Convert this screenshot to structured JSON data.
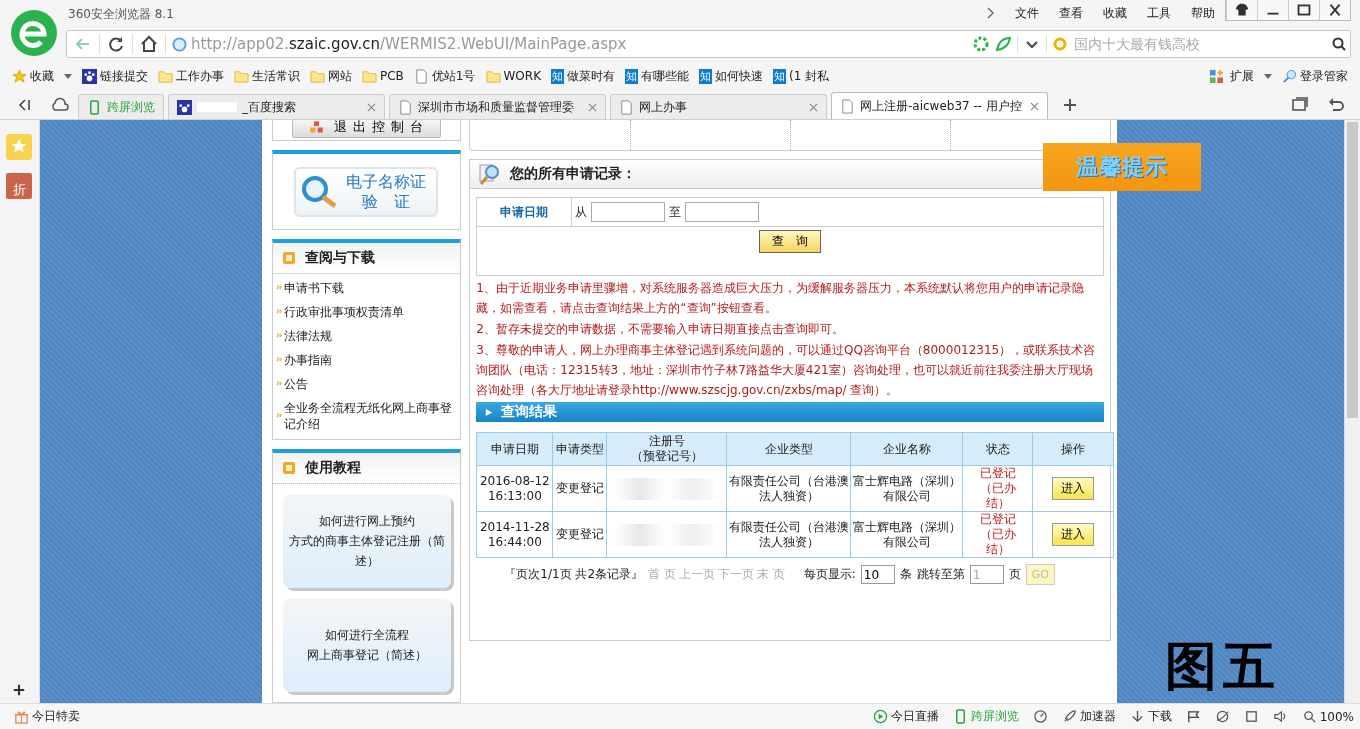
{
  "browser": {
    "title": "360安全浏览器 8.1",
    "menu": [
      "文件",
      "查看",
      "收藏",
      "工具",
      "帮助"
    ],
    "url": {
      "prefix": "http://app02.",
      "domain": "szaic.gov.cn",
      "path": "/WERMIS2.WebUI/MainPage.aspx"
    },
    "search": {
      "placeholder": "国内十大最有钱高校"
    },
    "bookmarks": [
      {
        "label": "收藏",
        "kind": "star"
      },
      {
        "label": "链接提交",
        "kind": "paw"
      },
      {
        "label": "工作办事",
        "kind": "folder"
      },
      {
        "label": "生活常识",
        "kind": "folder"
      },
      {
        "label": "网站",
        "kind": "folder"
      },
      {
        "label": "PCB",
        "kind": "folder"
      },
      {
        "label": "优站1号",
        "kind": "page"
      },
      {
        "label": "WORK",
        "kind": "folder"
      },
      {
        "label": "做菜时有",
        "kind": "zhi",
        "badge": "知"
      },
      {
        "label": "有哪些能",
        "kind": "zhi",
        "badge": "知"
      },
      {
        "label": "如何快速",
        "kind": "zhi",
        "badge": "知"
      },
      {
        "label": "(1 封私",
        "kind": "zhi",
        "badge": "知"
      }
    ],
    "bookmark_tools": [
      "扩展",
      "登录管家"
    ],
    "tabs": [
      {
        "label": "跨屏浏览",
        "kind": "phone",
        "selected": false
      },
      {
        "label": "_百度搜索",
        "kind": "paw",
        "selected": false
      },
      {
        "label": "深圳市市场和质量监督管理委",
        "kind": "page",
        "selected": false
      },
      {
        "label": "网上办事",
        "kind": "page",
        "selected": false
      },
      {
        "label": "网上注册-aicweb37 -- 用户控",
        "kind": "page",
        "selected": true
      }
    ]
  },
  "side_tools": [
    {
      "kind": "star"
    },
    {
      "kind": "sale",
      "label": "折"
    }
  ],
  "left_panel": {
    "logout_button": "退 出 控 制 台",
    "cert_button": [
      "电子名称证",
      "验　证"
    ],
    "sections": [
      {
        "title": "查阅与下载",
        "kind": "links",
        "items": [
          "申请书下载",
          "行政审批事项权责清单",
          "法律法规",
          "办事指南",
          "公告",
          "全业务全流程无纸化网上商事登记介绍"
        ]
      },
      {
        "title": "使用教程",
        "kind": "cards",
        "items": [
          [
            "如何进行网上预约",
            "方式的商事主体登记注册（简述）"
          ],
          [
            "如何进行全流程",
            "网上商事登记（简述）"
          ]
        ]
      }
    ]
  },
  "main": {
    "title": "您的所有申请记录：",
    "warm_tip": "温馨提示",
    "form": {
      "label": "申请日期",
      "from": "从",
      "to": "至",
      "button": "查　询"
    },
    "notices": [
      "1、由于近期业务申请里骤增，对系统服务器造成巨大压力，为缓解服务器压力，本系统默认将您用户的申请记录隐藏，如需查看，请点击查询结果上方的“查询”按钮查看。",
      "2、暂存未提交的申请数据，不需要输入申请日期直接点击查询即可。",
      "3、尊敬的申请人，网上办理商事主体登记遇到系统问题的，可以通过QQ咨询平台（8000012315），或联系技术咨询团队（电话：12315转3，地址：深圳市竹子林7路益华大厦421室）咨询处理，也可以就近前往我委注册大厅现场咨询处理（各大厅地址请登录http://www.szscjg.gov.cn/zxbs/map/ 查询）。"
    ],
    "results_title": "查询结果",
    "table": {
      "columns": [
        [
          "申请日期"
        ],
        [
          "申请类型"
        ],
        [
          "注册号",
          "（预登记号）"
        ],
        [
          "企业类型"
        ],
        [
          "企业名称"
        ],
        [
          "状态"
        ],
        [
          "操作"
        ]
      ],
      "rows": [
        {
          "date": "2016-08-12 16:13:00",
          "type": "变更登记",
          "company_type": "有限责任公司（台港澳法人独资）",
          "company": "富士辉电路（深圳）有限公司",
          "status": "已登记（已办结）",
          "action": "进入"
        },
        {
          "date": "2014-11-28 16:44:00",
          "type": "变更登记",
          "company_type": "有限责任公司（台港澳法人独资）",
          "company": "富士辉电路（深圳）有限公司",
          "status": "已登记（已办结）",
          "action": "进入"
        }
      ]
    },
    "pager": {
      "summary": "『页次1/1页 共2条记录』",
      "links": [
        {
          "label": "首 页",
          "disabled": true
        },
        {
          "label": "上一页",
          "disabled": true
        },
        {
          "label": "下一页",
          "disabled": true
        },
        {
          "label": "末 页",
          "disabled": true
        }
      ],
      "per_page_label": "每页显示:",
      "per_page": "10",
      "per_page_unit": "条",
      "jump_label": "跳转至第",
      "jump_page": "1",
      "jump_unit": "页",
      "go": "GO"
    }
  },
  "status_bar": {
    "left": "今日特卖",
    "items": [
      {
        "label": "今日直播",
        "kind": "play"
      },
      {
        "label": "跨屏浏览",
        "kind": "phone"
      },
      {
        "kind": "speed"
      },
      {
        "label": "加速器",
        "kind": "rocket"
      },
      {
        "label": "下载",
        "kind": "download"
      },
      {
        "kind": "flag"
      },
      {
        "kind": "ie"
      },
      {
        "kind": "window"
      },
      {
        "kind": "sound"
      },
      {
        "label": "100%",
        "kind": "zoom"
      }
    ]
  },
  "annotation": "图五"
}
